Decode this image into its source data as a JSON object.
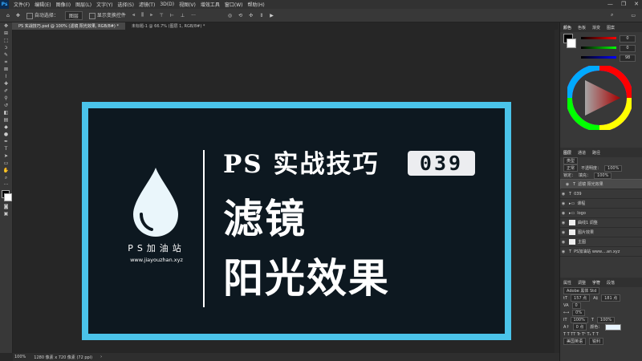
{
  "menu": {
    "logo": "Ps",
    "items": [
      "文件(F)",
      "编辑(E)",
      "图像(I)",
      "图层(L)",
      "文字(Y)",
      "选择(S)",
      "滤镜(T)",
      "3D(D)",
      "视图(V)",
      "增效工具",
      "窗口(W)",
      "帮助(H)"
    ],
    "window_buttons": [
      "—",
      "❐",
      "✕"
    ]
  },
  "options": {
    "auto_select": "自动选择：",
    "layer_select": "图层",
    "show_transform": "显示变换控件",
    "more": "···"
  },
  "tabs": [
    {
      "label": "PS 实战技巧.psd @ 100% (滤镜 阳光效果, RGB/8#) *",
      "active": true
    },
    {
      "label": "未标题-1 @ 66.7% (图层 1, RGB/8#) *",
      "active": false
    }
  ],
  "document": {
    "title": "PS 实战技巧",
    "badge": "039",
    "line1": "滤镜",
    "line2": "阳光效果",
    "brand": "PS加油站",
    "url": "www.jiayouzhan.xyz",
    "colors": {
      "frame": "#4ac3e9",
      "background": "#0d1820",
      "text": "#ffffff",
      "badge": "#ecedf0"
    }
  },
  "status": {
    "zoom": "100%",
    "size": "1280 像素 x 720 像素 (72 ppi)"
  },
  "right_panel": {
    "color_tabs": [
      "颜色",
      "色板",
      "渐变",
      "图案"
    ],
    "rgb_values": [
      "0",
      "0",
      "98"
    ],
    "layer_tabs": [
      "图层",
      "通道",
      "路径"
    ],
    "kind": "类型",
    "blend": "正常",
    "opacity_label": "不透明度：",
    "opacity": "100%",
    "lock_label": "锁定：",
    "fill_label": "填充：",
    "fill": "100%",
    "layers": [
      {
        "name": "滤镜 阳光效果",
        "type": "text",
        "selected": true
      },
      {
        "name": "039",
        "type": "text",
        "selected": false
      },
      {
        "name": "课程",
        "type": "group",
        "selected": false
      },
      {
        "name": "logo",
        "type": "group",
        "selected": false
      },
      {
        "name": "曲线1 调整",
        "type": "adjust",
        "selected": false
      },
      {
        "name": "图片效果",
        "type": "image",
        "selected": false
      },
      {
        "name": "主图",
        "type": "image",
        "selected": false
      },
      {
        "name": "PS加油站 www....an.xyz",
        "type": "text",
        "selected": false
      }
    ],
    "char_tabs": [
      "属性",
      "调整",
      "字符",
      "段落"
    ],
    "font_family": "Adobe 黑体 Std",
    "font_size": "157 点",
    "leading": "181 点",
    "tracking": "0",
    "kerning": "0%",
    "scale_v": "100%",
    "scale_h": "100%",
    "baseline": "0 点",
    "color_label": "颜色：",
    "lang": "美国英语",
    "aa": "锐利"
  }
}
